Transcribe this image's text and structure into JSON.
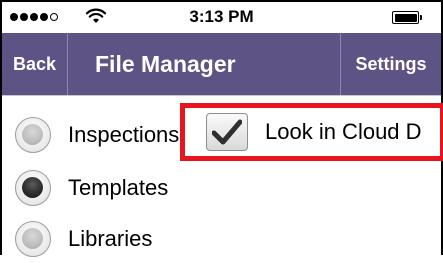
{
  "status_bar": {
    "time": "3:13 PM",
    "signal_dots_filled": 4,
    "signal_dots_total": 5,
    "battery_level": 1.0
  },
  "nav_bar": {
    "back_label": "Back",
    "title": "File Manager",
    "settings_label": "Settings",
    "background_color": "#5d5384"
  },
  "options": [
    {
      "label": "Inspections",
      "selected": false
    },
    {
      "label": "Templates",
      "selected": true
    },
    {
      "label": "Libraries",
      "selected": false
    }
  ],
  "cloud_option": {
    "label": "Look in Cloud D",
    "checked": true,
    "highlight_color": "#e8141d"
  }
}
